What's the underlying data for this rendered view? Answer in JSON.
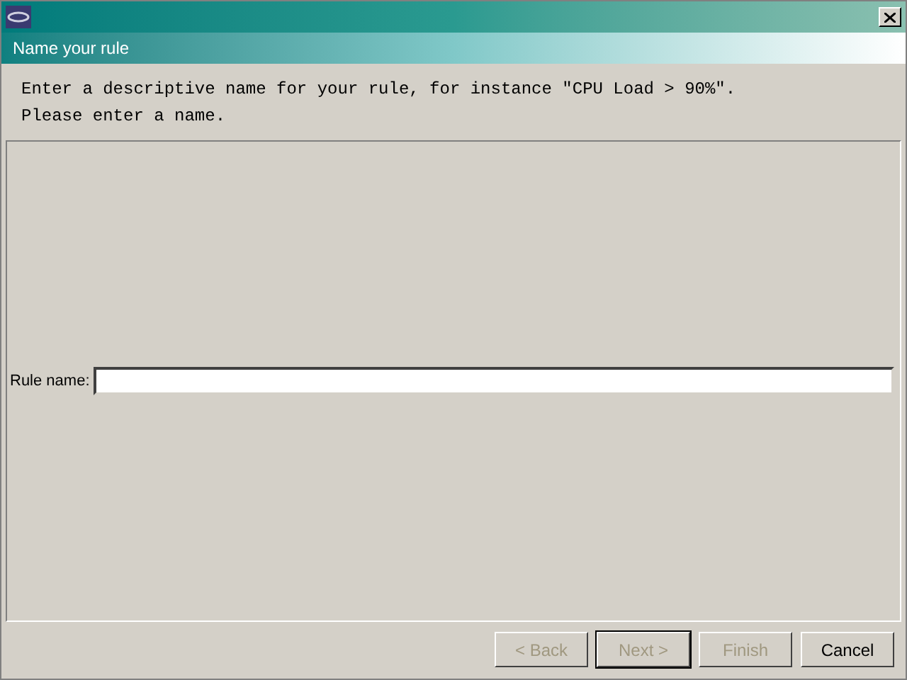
{
  "banner": {
    "title": "Name your rule"
  },
  "description": [
    "Enter a descriptive name for your rule, for instance \"CPU Load > 90%\".",
    "Please enter a name."
  ],
  "rule_name": {
    "label": "Rule name:"
  },
  "buttons": [
    {
      "label": "< Back",
      "disabled": true,
      "default": false
    },
    {
      "label": "Next >",
      "disabled": true,
      "default": true
    },
    {
      "label": "Finish",
      "disabled": true,
      "default": false
    },
    {
      "label": "Cancel",
      "disabled": false,
      "default": false
    }
  ]
}
